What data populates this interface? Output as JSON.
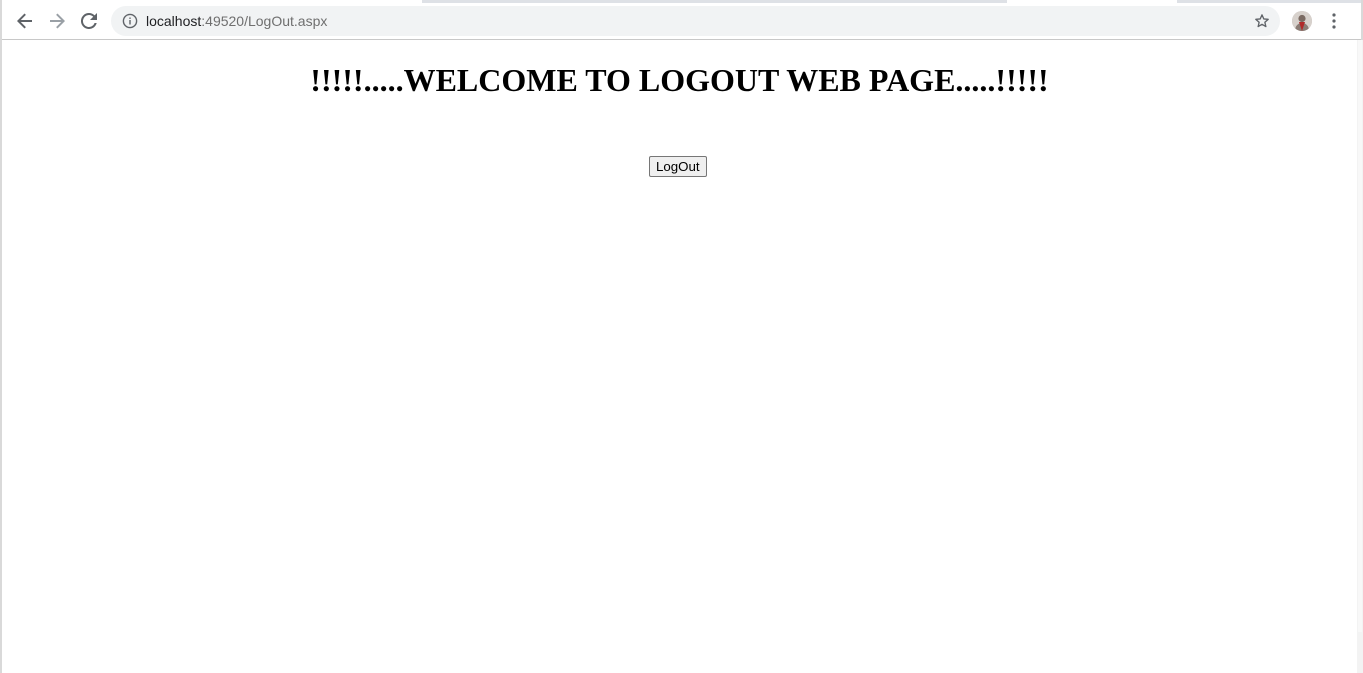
{
  "browser": {
    "url_host": "localhost",
    "url_rest": ":49520/LogOut.aspx",
    "icons": {
      "back": "back-arrow-icon",
      "forward": "forward-arrow-icon",
      "reload": "reload-icon",
      "site_info": "info-icon",
      "bookmark": "star-icon",
      "profile": "avatar",
      "menu": "kebab-menu-icon"
    }
  },
  "page": {
    "heading": "!!!!!.....WELCOME TO LOGOUT WEB PAGE.....!!!!!",
    "logout_label": "LogOut"
  },
  "colors": {
    "toolbar_bg": "#ffffff",
    "omnibox_bg": "#f1f3f4",
    "icon_color": "#5f6368",
    "button_bg": "#efefef",
    "text": "#000000"
  }
}
